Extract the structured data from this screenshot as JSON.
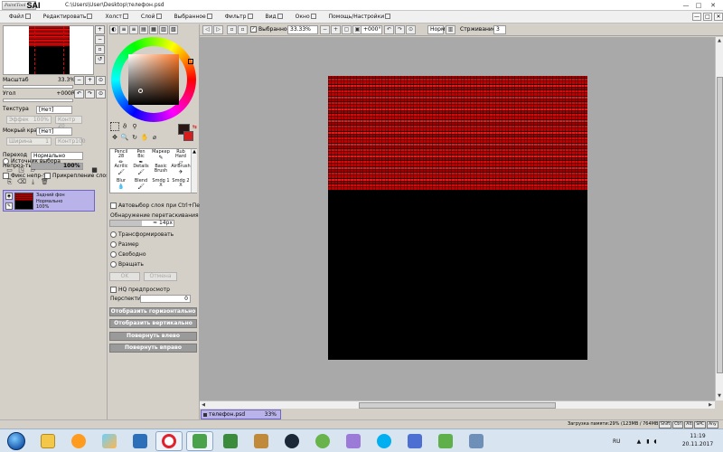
{
  "window": {
    "logo_small": "PaintTool",
    "logo_big": "SAI",
    "path": "C:\\Users\\User\\Desktop\\телефон.psd",
    "min_glyph": "—",
    "max_glyph": "□",
    "close_glyph": "✕"
  },
  "menu": {
    "items": [
      "Файл",
      "Редактировать",
      "Холст",
      "Слой",
      "Выбранное",
      "Фильтр",
      "Вид",
      "Окно",
      "Помощь/Настройки"
    ]
  },
  "navigator": {
    "zoom_label": "Масштаб",
    "zoom_value": "33.3%",
    "angle_label": "Угол",
    "angle_value": "+000R"
  },
  "texture": {
    "texture_label": "Текстура",
    "texture_value": "[Нет]",
    "effect_label": "Эффек",
    "effect_value": "100%",
    "effect2_value": "Контр 20",
    "wet_label": "Мокрый край",
    "wet_value": "[Нет]",
    "width_label": "Ширина",
    "width_value": "1",
    "wet2_value": "Контр100"
  },
  "blend": {
    "mode_label": "Переход",
    "mode_value": "Нормально",
    "opacity_label": "Непроз-ть",
    "opacity_value": "100%",
    "opacity_fill": 1.0,
    "protect_label": "Фикс непр-ть",
    "clip_label": "Прикрепление слоя",
    "source_label": "Источник выбора"
  },
  "layer": {
    "name": "Задний фон",
    "mode": "Нормально",
    "opacity": "100%"
  },
  "color": {
    "fg": "#2a1713",
    "bg": "#d91c1c",
    "accent": "#b9b3e9"
  },
  "brushes": [
    {
      "name": "Pencil",
      "size": "28"
    },
    {
      "name": "Pen",
      "size": "Bic"
    },
    {
      "name": "Маркер",
      "size": ""
    },
    {
      "name": "Rub",
      "size": "Hard"
    },
    {
      "name": "Acrilic",
      "size": ""
    },
    {
      "name": "Details",
      "size": ""
    },
    {
      "name": "Basic",
      "size": "Brush"
    },
    {
      "name": "AirBrush",
      "size": ""
    },
    {
      "name": "Blur",
      "size": ""
    },
    {
      "name": "Blend",
      "size": ""
    },
    {
      "name": "Smdg 1",
      "size": "X"
    },
    {
      "name": "Smdg 2",
      "size": "X"
    }
  ],
  "transform": {
    "autoselect": "Автовыбор слоя при Ctrl+Перетаскив",
    "detect_label": "Обнаружение перетаскивания",
    "detect_value": "14px",
    "opt_transform": "Трансформировать",
    "opt_scale": "Размер",
    "opt_free": "Свободно",
    "opt_rotate": "Вращать",
    "ok": "OK",
    "cancel": "Отмена",
    "hq": "HQ предпросмотр",
    "perspective_label": "Перспектива",
    "perspective_value": "0",
    "flip_h": "Отобразить горизонтально",
    "flip_v": "Отобразить вертикально",
    "rot_left": "Повернуть влево",
    "rot_right": "Повернуть вправо"
  },
  "toolbar": {
    "selection_label": "Выбранное",
    "zoom_value": "33.33%",
    "angle_value": "+000°",
    "mode_value": "Норм",
    "stabilizer_label": "Стрживание",
    "stabilizer_value": "3"
  },
  "document": {
    "tab_name": "телефон.psd",
    "tab_zoom": "33%"
  },
  "status": {
    "memory": "Загрузка памяти:29% (123MB / 764MB)",
    "keys": [
      "Shift",
      "Ctrl",
      "Alt",
      "SPC",
      "Any"
    ]
  },
  "taskbar": {
    "lang": "RU",
    "time": "11:19",
    "date": "20.11.2017"
  }
}
